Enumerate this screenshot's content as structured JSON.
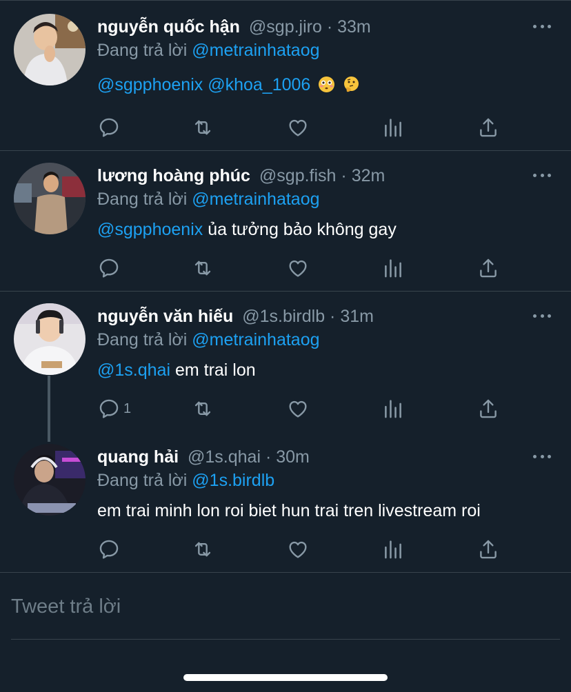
{
  "tweets": [
    {
      "name": "nguyễn quốc hận",
      "handle": "@sgp.jiro",
      "dot": "·",
      "time": "33m",
      "reply_prefix": "Đang trả lời",
      "reply_to": "@metrainhataog",
      "body_mentions": "@sgpphoenix @khoa_1006",
      "body_text": "",
      "emojis": [
        "flushed-face-emoji",
        "thinking-face-emoji"
      ],
      "reply_count": ""
    },
    {
      "name": "lương hoàng phúc",
      "handle": "@sgp.fish",
      "dot": "·",
      "time": "32m",
      "reply_prefix": "Đang trả lời",
      "reply_to": "@metrainhataog",
      "body_mentions": "@sgpphoenix",
      "body_text": " ủa tưởng bảo không gay",
      "reply_count": ""
    },
    {
      "name": "nguyễn văn hiếu",
      "handle": "@1s.birdlb",
      "dot": "·",
      "time": "31m",
      "reply_prefix": "Đang trả lời",
      "reply_to": "@metrainhataog",
      "body_mentions": "@1s.qhai",
      "body_text": " em trai lon",
      "reply_count": "1"
    },
    {
      "name": "quang hải",
      "handle": "@1s.qhai",
      "dot": "·",
      "time": "30m",
      "reply_prefix": "Đang trả lời",
      "reply_to": "@1s.birdlb",
      "body_mentions": "",
      "body_text": "em trai minh lon roi biet hun trai tren livestream roi",
      "reply_count": ""
    }
  ],
  "reply_box": {
    "placeholder": "Tweet trả lời"
  },
  "icons": [
    "reply-icon",
    "retweet-icon",
    "like-icon",
    "analytics-icon",
    "share-icon",
    "more-icon"
  ],
  "colors": {
    "background": "#15202b",
    "mention": "#1da1f2",
    "muted": "#8899a6",
    "divider": "#38444d"
  }
}
